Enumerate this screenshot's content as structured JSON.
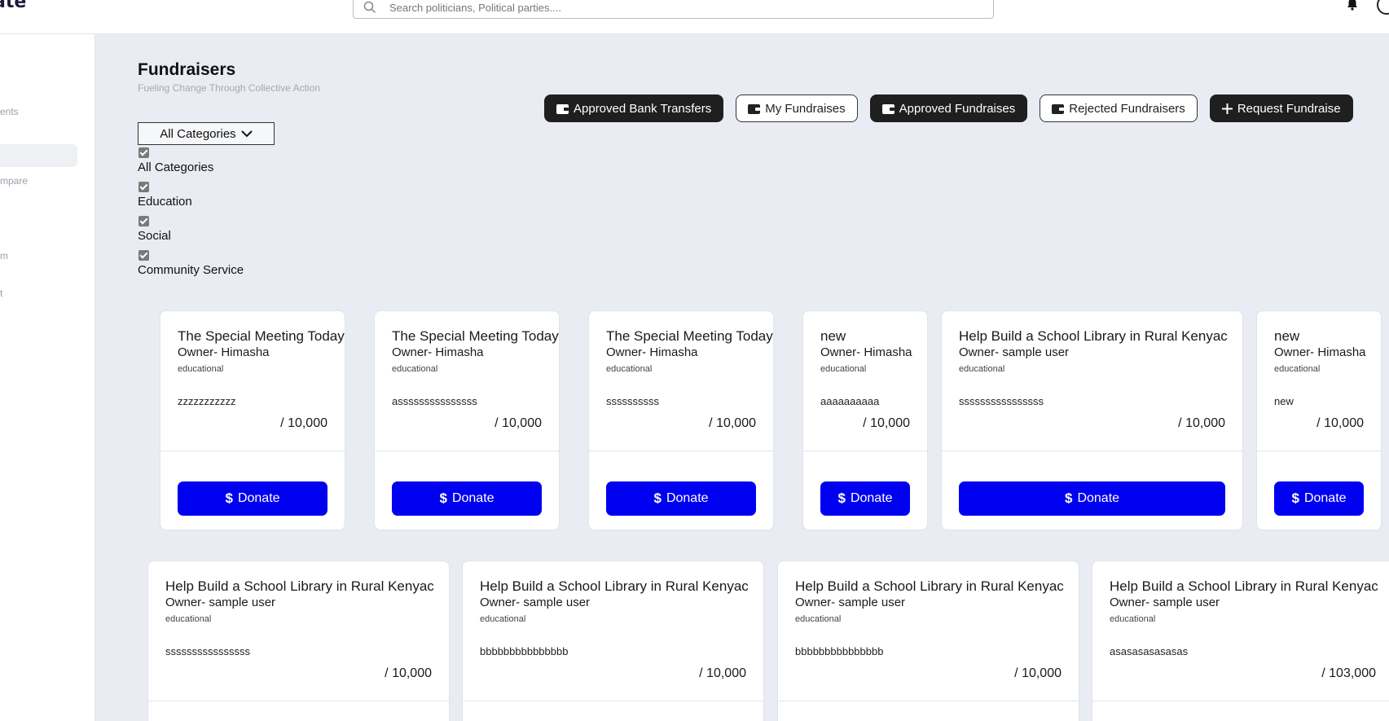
{
  "header": {
    "logo_text": "ate",
    "search_placeholder": "Search politicians, Political parties...."
  },
  "sidebar": {
    "items": [
      "ents",
      "mpare",
      "m",
      "t"
    ]
  },
  "page": {
    "title": "Fundraisers",
    "subtitle": "Fueling Change Through Collective Action"
  },
  "actions": [
    {
      "label": "Approved Bank Transfers",
      "style": "dark",
      "icon": "wallet-icon"
    },
    {
      "label": "My Fundraises",
      "style": "light",
      "icon": "wallet-icon"
    },
    {
      "label": "Approved Fundraises",
      "style": "dark",
      "icon": "wallet-icon"
    },
    {
      "label": "Rejected Fundraisers",
      "style": "light",
      "icon": "wallet-icon"
    },
    {
      "label": "Request Fundraise",
      "style": "dark",
      "icon": "plus-icon"
    }
  ],
  "filter": {
    "select_label": "All Categories",
    "options": [
      {
        "label": "All Categories",
        "checked": true
      },
      {
        "label": "Education",
        "checked": true
      },
      {
        "label": "Social",
        "checked": true
      },
      {
        "label": "Community Service",
        "checked": true
      }
    ]
  },
  "donate_label": "Donate",
  "cards_row1": [
    {
      "title": "The Special Meeting Today",
      "owner": "Owner- Himasha",
      "category": "educational",
      "description": "zzzzzzzzzzz",
      "goal": "/ 10,000"
    },
    {
      "title": "The Special Meeting Today",
      "owner": "Owner- Himasha",
      "category": "educational",
      "description": "asssssssssssssss",
      "goal": "/ 10,000"
    },
    {
      "title": "The Special Meeting Today",
      "owner": "Owner- Himasha",
      "category": "educational",
      "description": "ssssssssss",
      "goal": "/ 10,000"
    },
    {
      "title": "new",
      "owner": "Owner- Himasha",
      "category": "educational",
      "description": "aaaaaaaaaa",
      "goal": "/ 10,000"
    },
    {
      "title": "Help Build a School Library in Rural Kenyac",
      "owner": "Owner- sample user",
      "category": "educational",
      "description": "ssssssssssssssss",
      "goal": "/ 10,000"
    },
    {
      "title": "new",
      "owner": "Owner- Himasha",
      "category": "educational",
      "description": "new",
      "goal": "/ 10,000"
    }
  ],
  "cards_row2": [
    {
      "title": "Help Build a School Library in Rural Kenyac",
      "owner": "Owner- sample user",
      "category": "educational",
      "description": "ssssssssssssssss",
      "goal": "/ 10,000"
    },
    {
      "title": "Help Build a School Library in Rural Kenyac",
      "owner": "Owner- sample user",
      "category": "educational",
      "description": "bbbbbbbbbbbbbbb",
      "goal": "/ 10,000"
    },
    {
      "title": "Help Build a School Library in Rural Kenyac",
      "owner": "Owner- sample user",
      "category": "educational",
      "description": "bbbbbbbbbbbbbbb",
      "goal": "/ 10,000"
    },
    {
      "title": "Help Build a School Library in Rural Kenyac",
      "owner": "Owner- sample user",
      "category": "educational",
      "description": "asasasasasasas",
      "goal": "/ 103,000"
    }
  ],
  "colors": {
    "accent": "#0000f0",
    "dark_button": "#1f1f1f",
    "main_bg": "#e9ecf2"
  }
}
